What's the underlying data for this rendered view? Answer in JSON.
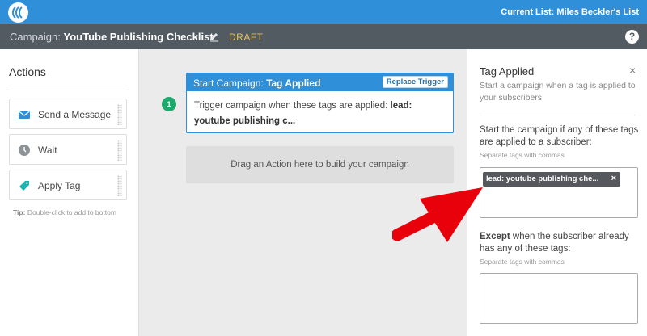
{
  "topbar": {
    "current_list": "Current List: Miles Beckler's List",
    "brand_color": "#2f8fd8"
  },
  "campaign_bar": {
    "prefix": "Campaign:",
    "name": "YouTube Publishing Checklist",
    "status": "DRAFT",
    "help_label": "?"
  },
  "actions_panel": {
    "title": "Actions",
    "items": [
      {
        "label": "Send a Message",
        "icon": "envelope-icon"
      },
      {
        "label": "Wait",
        "icon": "clock-icon"
      },
      {
        "label": "Apply Tag",
        "icon": "tag-icon"
      }
    ],
    "tip_label": "Tip:",
    "tip_text": "Double-click to add to bottom"
  },
  "canvas": {
    "step_number": "1",
    "trigger": {
      "prefix": "Start Campaign:",
      "name": "Tag Applied",
      "replace_button": "Replace Trigger",
      "body_text": "Trigger campaign when these tags are applied:",
      "body_tag": "lead: youtube publishing c..."
    },
    "dropzone_text": "Drag an Action here to build your campaign"
  },
  "settings_panel": {
    "title": "Tag Applied",
    "close_label": "×",
    "description": "Start a campaign when a tag is applied to your subscribers",
    "any_tags_label": "Start the campaign if any of these tags are applied to a subscriber:",
    "any_tags_hint": "Separate tags with commas",
    "selected_tags": [
      {
        "label": "lead: youtube publishing che...",
        "remove": "×"
      }
    ],
    "except_bold": "Except",
    "except_rest": "when the subscriber already has any of these tags:",
    "except_hint": "Separate tags with commas",
    "except_value": ""
  },
  "colors": {
    "accent": "#2f8fd8",
    "header_gray": "#525a62",
    "draft": "#e3c25a",
    "step_green": "#1ea86b",
    "annotation_arrow": "#e8000b"
  }
}
